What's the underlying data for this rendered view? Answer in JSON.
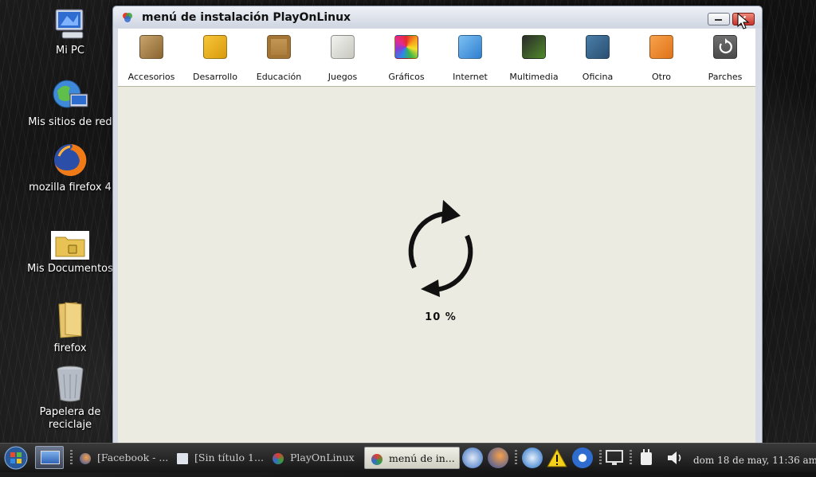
{
  "desktop": {
    "icons": [
      {
        "label": "Mi PC"
      },
      {
        "label": "Mis sitios de red"
      },
      {
        "label": "mozilla firefox 4"
      },
      {
        "label": "Mis Documentos"
      },
      {
        "label": "firefox"
      },
      {
        "label": "Papelera  de reciclaje"
      }
    ]
  },
  "window": {
    "title": "menú de instalación PlayOnLinux",
    "categories": [
      {
        "label": "Accesorios",
        "icon": "calculator-icon"
      },
      {
        "label": "Desarrollo",
        "icon": "construction-icon"
      },
      {
        "label": "Educación",
        "icon": "chalkboard-icon"
      },
      {
        "label": "Juegos",
        "icon": "gamepad-icon"
      },
      {
        "label": "Gráficos",
        "icon": "color-wheel-icon"
      },
      {
        "label": "Internet",
        "icon": "network-icon"
      },
      {
        "label": "Multimedia",
        "icon": "film-music-icon"
      },
      {
        "label": "Oficina",
        "icon": "chart-icon"
      },
      {
        "label": "Otro",
        "icon": "gears-icon"
      },
      {
        "label": "Parches",
        "icon": "refresh-icon"
      }
    ],
    "progress": {
      "label": "10 %",
      "value": 0.1
    }
  },
  "taskbar": {
    "tasks": [
      {
        "label": "[Facebook - ..."
      },
      {
        "label": "[Sin título 1..."
      },
      {
        "label": "PlayOnLinux"
      },
      {
        "label": "menú de in..."
      }
    ],
    "clock": "dom 18 de may, 11:36 am"
  },
  "colors": {
    "content_bg": "#ecebe1",
    "titlebar": "#d6dbe6",
    "close_button": "#c8322a"
  }
}
